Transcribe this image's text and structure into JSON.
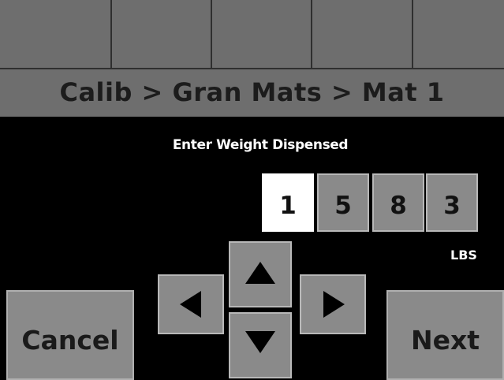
{
  "screen": {
    "breadcrumb": "Calib > Gran Mats > Mat 1",
    "prompt": "Enter Weight Dispensed",
    "digits": [
      "1",
      "5",
      "8",
      "3"
    ],
    "selected_digit_index": 0,
    "unit": "LBS",
    "cancel_label": "Cancel",
    "next_label": "Next"
  },
  "icons": {
    "up": "arrow-up-icon",
    "down": "arrow-down-icon",
    "left": "arrow-left-icon",
    "right": "arrow-right-icon"
  },
  "colors": {
    "background": "#000000",
    "panel_gray": "#6e6e6e",
    "button_gray": "#8a8a8a",
    "selected_digit": "#ffffff",
    "text_dark": "#1c1c1c",
    "text_light": "#ffffff"
  }
}
